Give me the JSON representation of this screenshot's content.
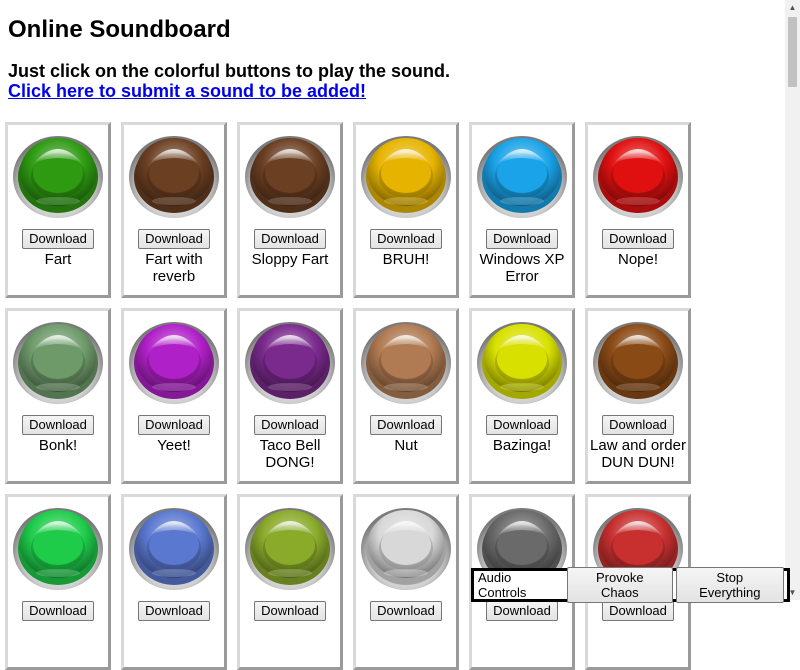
{
  "page": {
    "title": "Online Soundboard",
    "instruction": "Just click on the colorful buttons to play the sound.",
    "submit_link": "Click here to submit a sound to be added!"
  },
  "download_label": "Download",
  "sounds": [
    {
      "label": "Fart",
      "color": "#2e9a12"
    },
    {
      "label": "Fart with reverb",
      "color": "#6b3f22"
    },
    {
      "label": "Sloppy Fart",
      "color": "#6b3f22"
    },
    {
      "label": "BRUH!",
      "color": "#e6b400"
    },
    {
      "label": "Windows XP Error",
      "color": "#1aa3e8"
    },
    {
      "label": "Nope!",
      "color": "#e01010"
    },
    {
      "label": "Bonk!",
      "color": "#6e9a6a"
    },
    {
      "label": "Yeet!",
      "color": "#b020c8"
    },
    {
      "label": "Taco Bell DONG!",
      "color": "#7a2a8c"
    },
    {
      "label": "Nut",
      "color": "#b07a52"
    },
    {
      "label": "Bazinga!",
      "color": "#d8e000"
    },
    {
      "label": "Law and order DUN DUN!",
      "color": "#8a4a16"
    },
    {
      "label": "",
      "color": "#1ecc4a"
    },
    {
      "label": "",
      "color": "#5a78d0"
    },
    {
      "label": "",
      "color": "#8aaa2a"
    },
    {
      "label": "",
      "color": "#d8d8d8"
    },
    {
      "label": "",
      "color": "#6a6a6a"
    },
    {
      "label": "",
      "color": "#c83030"
    }
  ],
  "audio_controls": {
    "label": "Audio Controls",
    "chaos_button": "Provoke Chaos",
    "stop_button": "Stop Everything"
  }
}
